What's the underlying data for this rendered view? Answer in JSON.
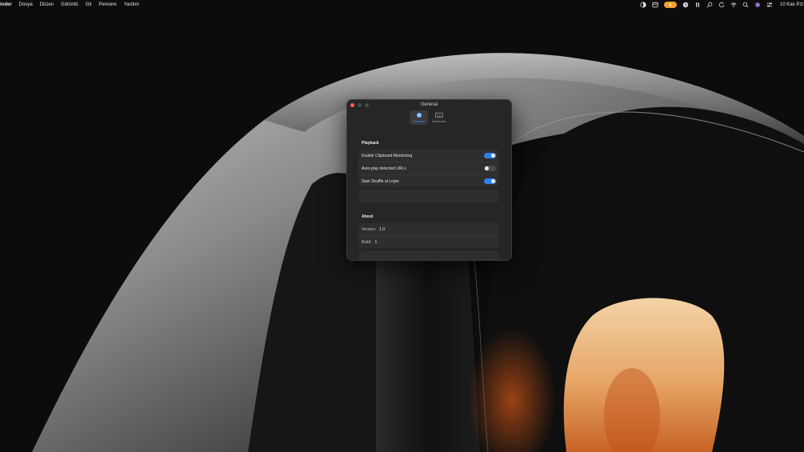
{
  "menubar": {
    "app_name": "inder",
    "items": [
      "Dosya",
      "Düzen",
      "Görüntü",
      "Git",
      "Pencere",
      "Yardım"
    ],
    "clock": "10 Kas Pzt"
  },
  "window": {
    "title": "General",
    "tabs": [
      {
        "label": "General",
        "icon": "gear-icon",
        "active": true
      },
      {
        "label": "Shortcuts",
        "icon": "keyboard-icon",
        "active": false
      }
    ],
    "playback": {
      "title": "Playback",
      "rows": [
        {
          "label": "Enable Clipboard Monitoring",
          "on": true
        },
        {
          "label": "Auto-play detected URLs",
          "on": false
        },
        {
          "label": "Start Shuffle at Login",
          "on": true
        }
      ]
    },
    "about": {
      "title": "About",
      "version_label": "Version:",
      "version_value": "1.0",
      "build_label": "Build:",
      "build_value": "1"
    }
  },
  "colors": {
    "accent": "#2f80ed",
    "close": "#ff5f57",
    "amber": "#f5a02a",
    "window_bg": "#262626"
  }
}
